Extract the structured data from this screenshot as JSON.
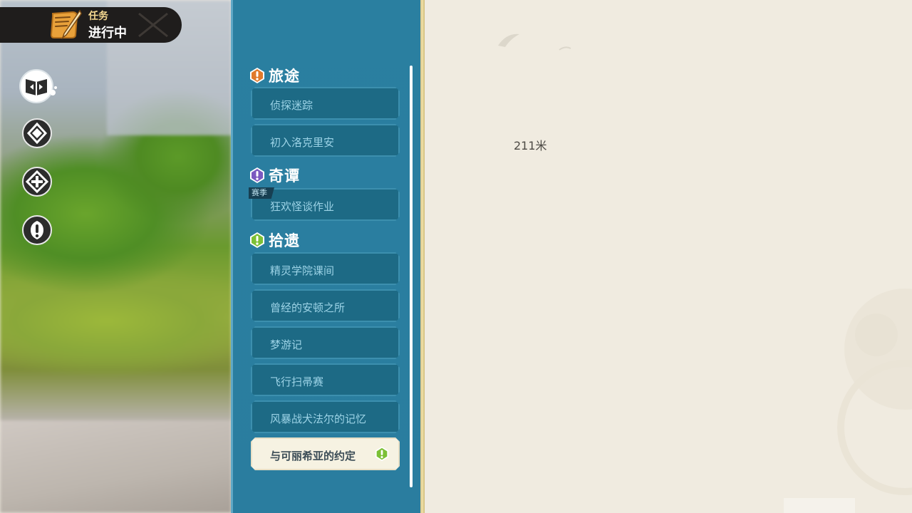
{
  "hud": {
    "quest_label_top": "任务",
    "quest_label_main": "进行中",
    "icons": [
      "scroll-quill-icon",
      "journey-book-icon",
      "wonder-tale-icon",
      "stray-find-icon",
      "alert-icon"
    ]
  },
  "categories": [
    {
      "key": "journey",
      "title": "旅途",
      "color": "#e07a2c"
    },
    {
      "key": "wonder",
      "title": "奇谭",
      "color": "#7b5ac0"
    },
    {
      "key": "stray",
      "title": "拾遗",
      "color": "#7cc036"
    }
  ],
  "quests": {
    "journey": [
      "侦探迷踪",
      "初入洛克里安"
    ],
    "wonder": [
      "狂欢怪谈作业"
    ],
    "stray": [
      "精灵学院课间",
      "曾经的安顿之所",
      "梦游记",
      "飞行扫帚赛",
      "风暴战犬法尔的记忆",
      "与可丽希亚的约定"
    ]
  },
  "season_tag": "赛季",
  "selected_quest": "与可丽希亚的约定",
  "map": {
    "distance": "211米"
  },
  "colors": {
    "panel": "#2a7fa0",
    "quest_bg": "#1d6a85",
    "quest_text": "#9cd3e6",
    "selected_bg": "#f6f2e2",
    "parchment": "#f0ebe0"
  }
}
